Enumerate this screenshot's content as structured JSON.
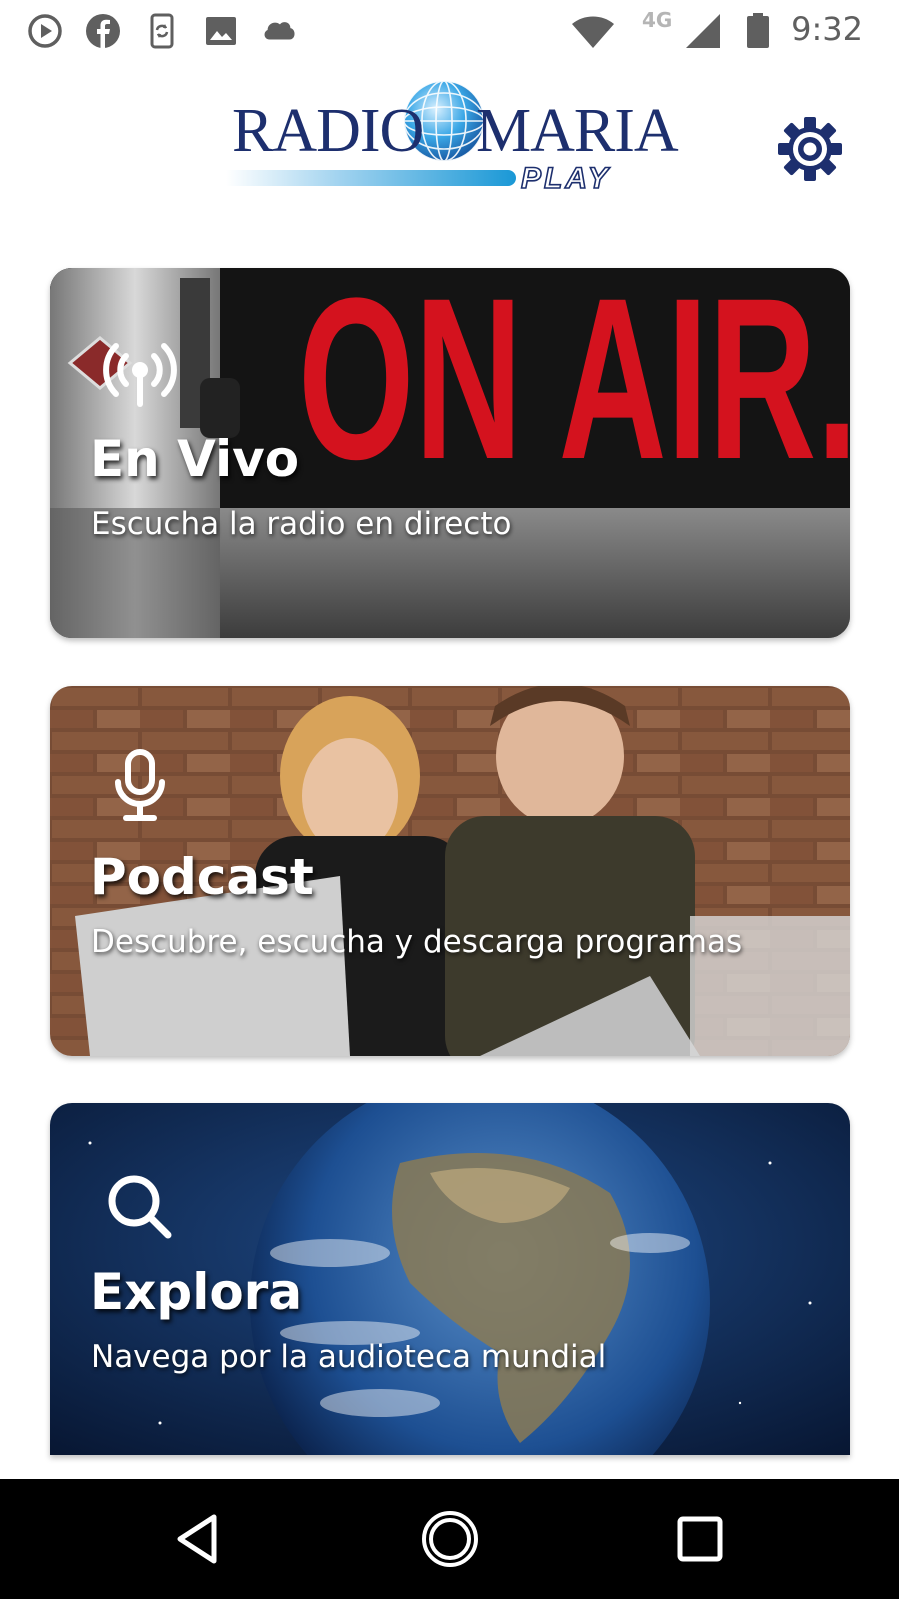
{
  "status_bar": {
    "time": "9:32",
    "network": "4G",
    "left_icons": [
      "play-circle-icon",
      "facebook-icon",
      "phone-sync-icon",
      "image-icon",
      "cloud-icon"
    ],
    "right_icons": [
      "wifi-icon",
      "cell-signal-icon",
      "battery-icon"
    ]
  },
  "header": {
    "logo_text_1": "RADIO",
    "logo_text_2": "MARIA",
    "logo_text_3": "PLAY",
    "settings_icon": "gear-icon"
  },
  "cards": [
    {
      "title": "En Vivo",
      "subtitle": "Escucha la radio en directo",
      "icon": "broadcast-icon",
      "background_text": "ON AIR."
    },
    {
      "title": "Podcast",
      "subtitle": "Descubre, escucha y descarga programas",
      "icon": "microphone-icon"
    },
    {
      "title": "Explora",
      "subtitle": "Navega por la audioteca mundial",
      "icon": "search-icon"
    }
  ],
  "nav_bar": {
    "buttons": [
      "back-icon",
      "home-icon",
      "recents-icon"
    ]
  },
  "colors": {
    "brand_navy": "#1d2f6e",
    "brand_blue": "#1a98d6",
    "on_air_red": "#d4121e",
    "nav_background": "#000000"
  }
}
